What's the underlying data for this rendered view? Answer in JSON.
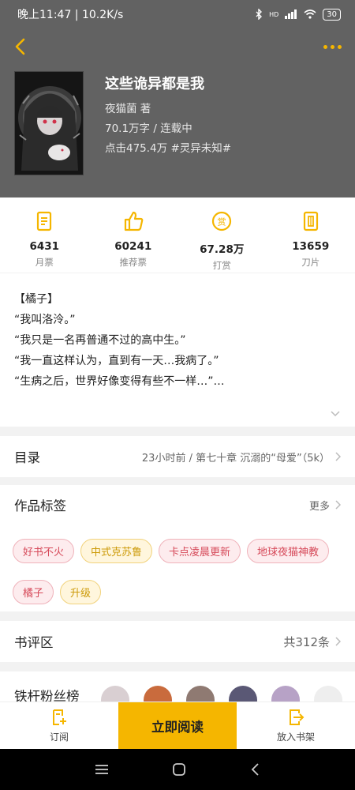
{
  "status_bar": {
    "time": "晚上11:47 | 10.2K/s",
    "battery": "30",
    "signal_label": "HD"
  },
  "book": {
    "title": "这些诡异都是我",
    "author_line": "夜猫菌  著",
    "words_line": "70.1万字 / 连载中",
    "clicks_line": "点击475.4万  #灵异未知#"
  },
  "stats": [
    {
      "icon": "monthly-ticket-icon",
      "value": "6431",
      "label": "月票"
    },
    {
      "icon": "thumbs-up-icon",
      "value": "60241",
      "label": "推荐票"
    },
    {
      "icon": "reward-coin-icon",
      "value": "67.28万",
      "label": "打赏"
    },
    {
      "icon": "blade-card-icon",
      "value": "13659",
      "label": "刀片"
    }
  ],
  "coin_glyph": "赏",
  "intro": [
    "【橘子】",
    "“我叫洛泠。”",
    "“我只是一名再普通不过的高中生。”",
    "“我一直这样认为，直到有一天…我病了。”",
    "“生病之后，世界好像变得有些不一样…”…"
  ],
  "catalog": {
    "title": "目录",
    "latest": "23小时前 / 第七十章 沉溺的“母爱”（5k）"
  },
  "tags_section": {
    "title": "作品标签",
    "more": "更多",
    "tags": [
      {
        "label": "好书不火",
        "color": "red"
      },
      {
        "label": "中式克苏鲁",
        "color": "yellow"
      },
      {
        "label": "卡点凌晨更新",
        "color": "red"
      },
      {
        "label": "地球夜猫神教",
        "color": "red"
      },
      {
        "label": "橘子",
        "color": "red"
      },
      {
        "label": "升级",
        "color": "yellow"
      }
    ]
  },
  "reviews": {
    "title": "书评区",
    "count": "共312条"
  },
  "fans": {
    "title": "铁杆粉丝榜"
  },
  "bottom_bar": {
    "subscribe": "订阅",
    "read_now": "立即阅读",
    "add_shelf": "放入书架"
  },
  "colors": {
    "accent": "#f5b600",
    "header_bg": "#626262"
  }
}
